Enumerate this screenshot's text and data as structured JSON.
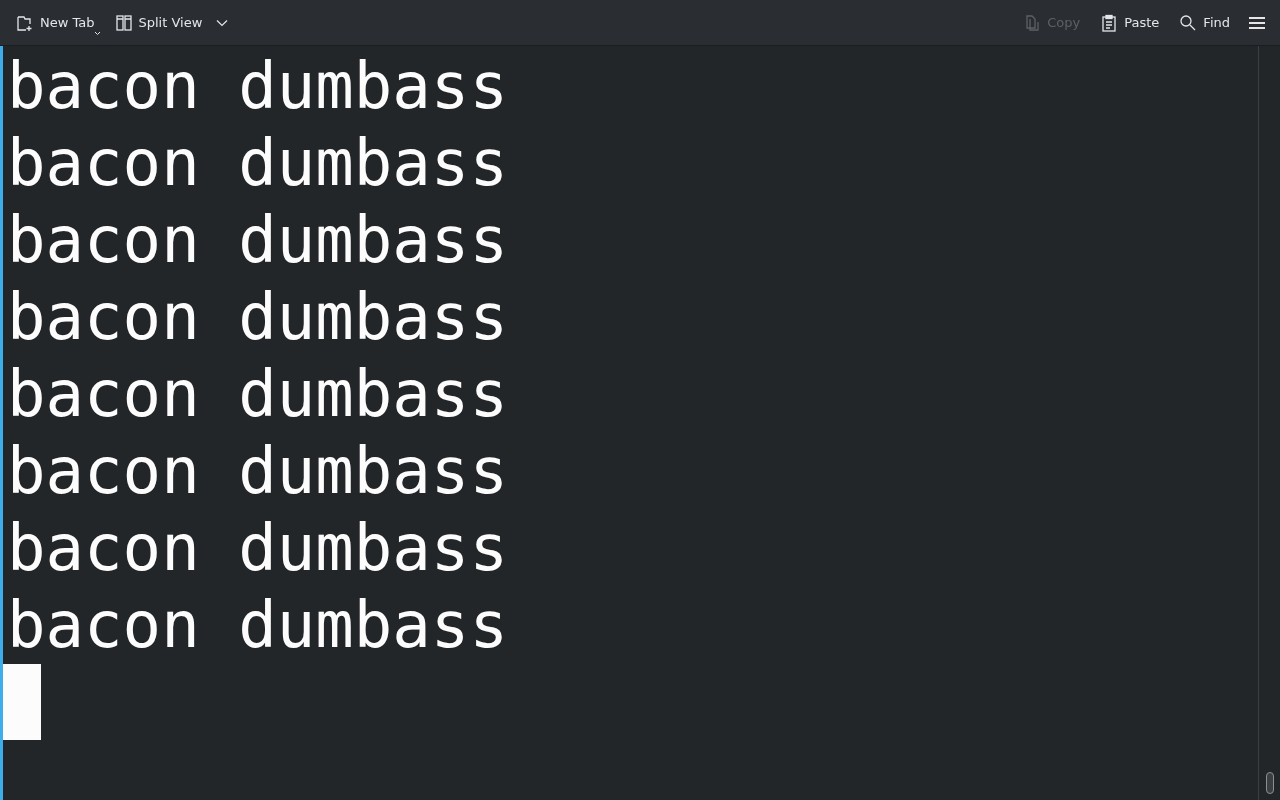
{
  "toolbar": {
    "left": [
      {
        "label": "New Tab",
        "kind": "new-tab",
        "disabled": false
      },
      {
        "label": "Split View",
        "kind": "split-view",
        "disabled": false
      }
    ],
    "right": [
      {
        "label": "Copy",
        "kind": "copy",
        "disabled": true
      },
      {
        "label": "Paste",
        "kind": "paste",
        "disabled": false
      },
      {
        "label": "Find",
        "kind": "find",
        "disabled": false
      }
    ]
  },
  "terminal": {
    "lines": [
      "bacon dumbass",
      "bacon dumbass",
      "bacon dumbass",
      "bacon dumbass",
      "bacon dumbass",
      "bacon dumbass",
      "bacon dumbass",
      "bacon dumbass"
    ],
    "focused": true
  }
}
